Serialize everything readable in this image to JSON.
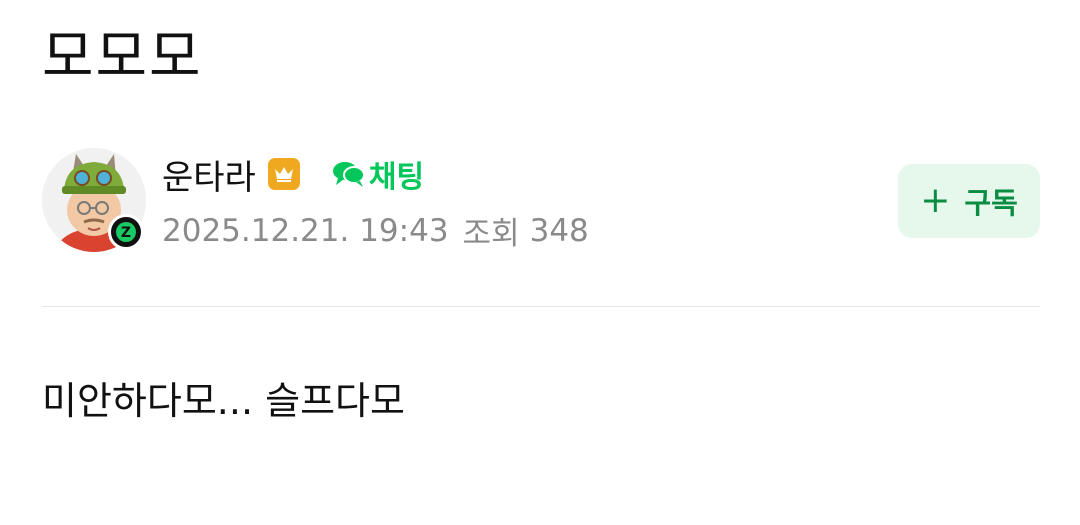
{
  "post": {
    "title": "모모모",
    "body": "미안하다모... 슬프다모"
  },
  "author": {
    "name": "운타라",
    "date": "2025.12.21. 19:43",
    "views_label": "조회",
    "views": "348",
    "level_badge_letter": "Z"
  },
  "chat": {
    "label": "채팅"
  },
  "subscribe": {
    "plus": "+",
    "label": "구독"
  },
  "colors": {
    "accent_green": "#03c75a",
    "subscribe_bg": "#e6f7ec",
    "subscribe_text": "#0a8c43",
    "crown_badge": "#f0a820",
    "meta_gray": "#8a8a8a"
  }
}
